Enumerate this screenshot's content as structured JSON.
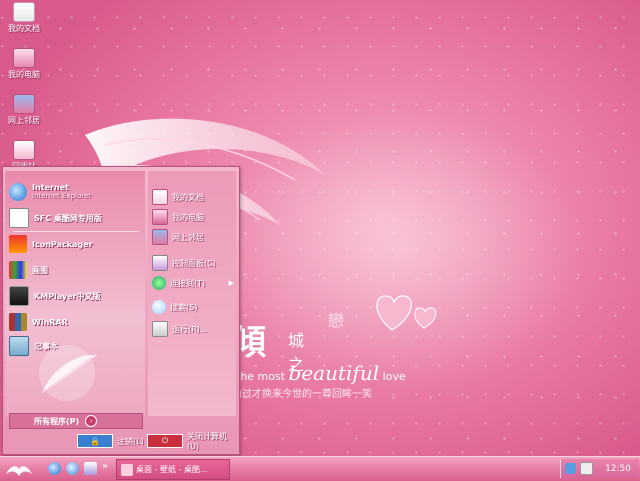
{
  "desktop": {
    "icons": [
      {
        "label": "我的文档",
        "icon": "my-documents-icon"
      },
      {
        "label": "我的电脑",
        "icon": "my-computer-icon"
      },
      {
        "label": "网上邻居",
        "icon": "network-places-icon"
      },
      {
        "label": "回收站",
        "icon": "recycle-bin-icon"
      }
    ],
    "wallpaper": {
      "big_text": "傾",
      "mid_text": "城之",
      "love_text": "戀",
      "line_prefix": "the most ",
      "line_script": "beautiful",
      "line_suffix": " love",
      "subtitle": "前过才换来今世的一尊回眸一笑"
    }
  },
  "start_menu": {
    "pinned": [
      {
        "label": "Internet",
        "sublabel": "Internet Explorer",
        "icon": "internet-explorer-icon"
      },
      {
        "label": "SFC 桌酷网专用版",
        "icon": "sfc-icon"
      }
    ],
    "recent": [
      {
        "label": "IconPackager",
        "icon": "iconpackager-icon"
      },
      {
        "label": "画图",
        "icon": "paint-icon"
      },
      {
        "label": "KMPlayer中文版",
        "icon": "kmplayer-icon"
      },
      {
        "label": "WinRAR",
        "icon": "winrar-icon"
      },
      {
        "label": "记事本",
        "icon": "notepad-icon"
      }
    ],
    "all_programs": "所有程序(P)",
    "right": [
      {
        "label": "我的文档",
        "icon": "my-documents-icon"
      },
      {
        "label": "我的电脑",
        "icon": "my-computer-icon"
      },
      {
        "label": "网上邻居",
        "icon": "network-places-icon"
      },
      {
        "label": "控制面板(C)",
        "icon": "control-panel-icon"
      },
      {
        "label": "连接到(T)",
        "icon": "connect-to-icon"
      },
      {
        "label": "搜索(S)",
        "icon": "search-icon"
      },
      {
        "label": "运行(R)...",
        "icon": "run-icon"
      }
    ],
    "logoff": "注销(L)",
    "shutdown": "关闭计算机(U)"
  },
  "taskbar": {
    "overflow": "»",
    "task_label": "桌面 - 壁纸 - 桌酷...",
    "clock": "12:50"
  },
  "colors": {
    "accent": "#e6709c",
    "taskbar": "#e67aa2"
  }
}
